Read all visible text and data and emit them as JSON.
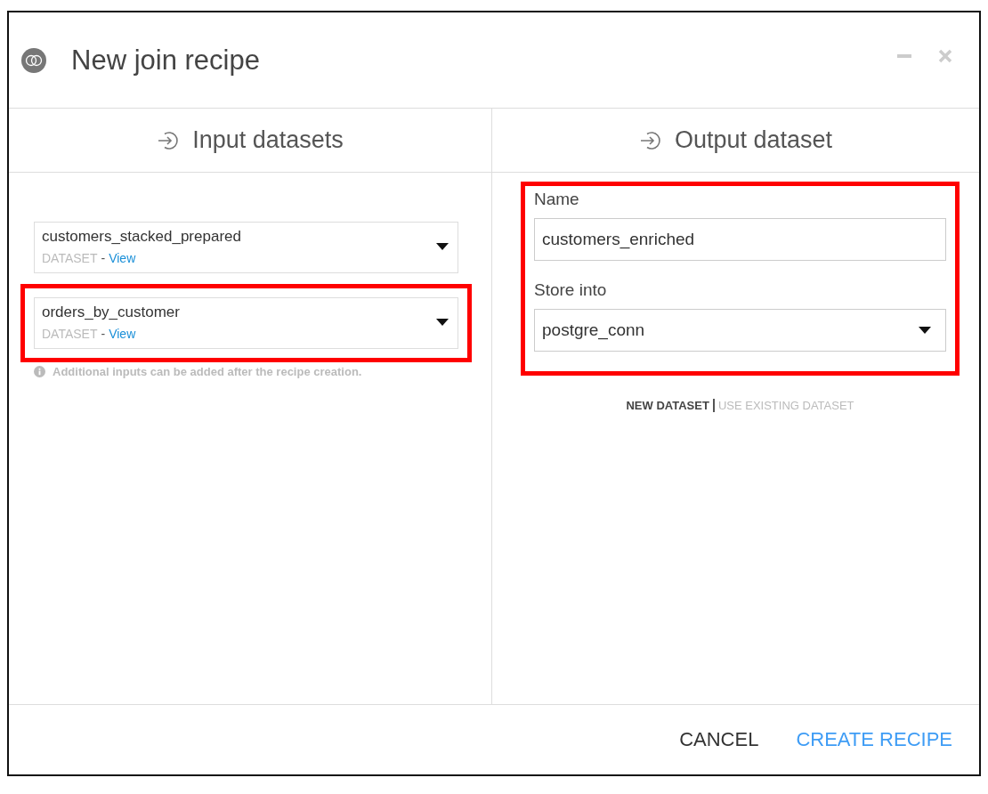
{
  "window": {
    "title": "New join recipe"
  },
  "columns": [
    {
      "title": "Input datasets"
    },
    {
      "title": "Output dataset"
    }
  ],
  "inputs": [
    {
      "name": "customers_stacked_prepared",
      "type": "DATASET",
      "separator": "-",
      "link": "View",
      "highlighted": false
    },
    {
      "name": "orders_by_customer",
      "type": "DATASET",
      "separator": "-",
      "link": "View",
      "highlighted": true
    }
  ],
  "inputs_note": "Additional inputs can be added after the recipe creation.",
  "output": {
    "highlighted": true,
    "name_label": "Name",
    "name_value": "customers_enriched",
    "store_label": "Store into",
    "store_value": "postgre_conn",
    "modes": [
      {
        "label": "NEW DATASET",
        "selected": true
      },
      {
        "label": "USE EXISTING DATASET",
        "selected": false
      }
    ]
  },
  "buttons": [
    {
      "label": "CANCEL",
      "kind": "secondary"
    },
    {
      "label": "CREATE RECIPE",
      "kind": "primary"
    }
  ]
}
